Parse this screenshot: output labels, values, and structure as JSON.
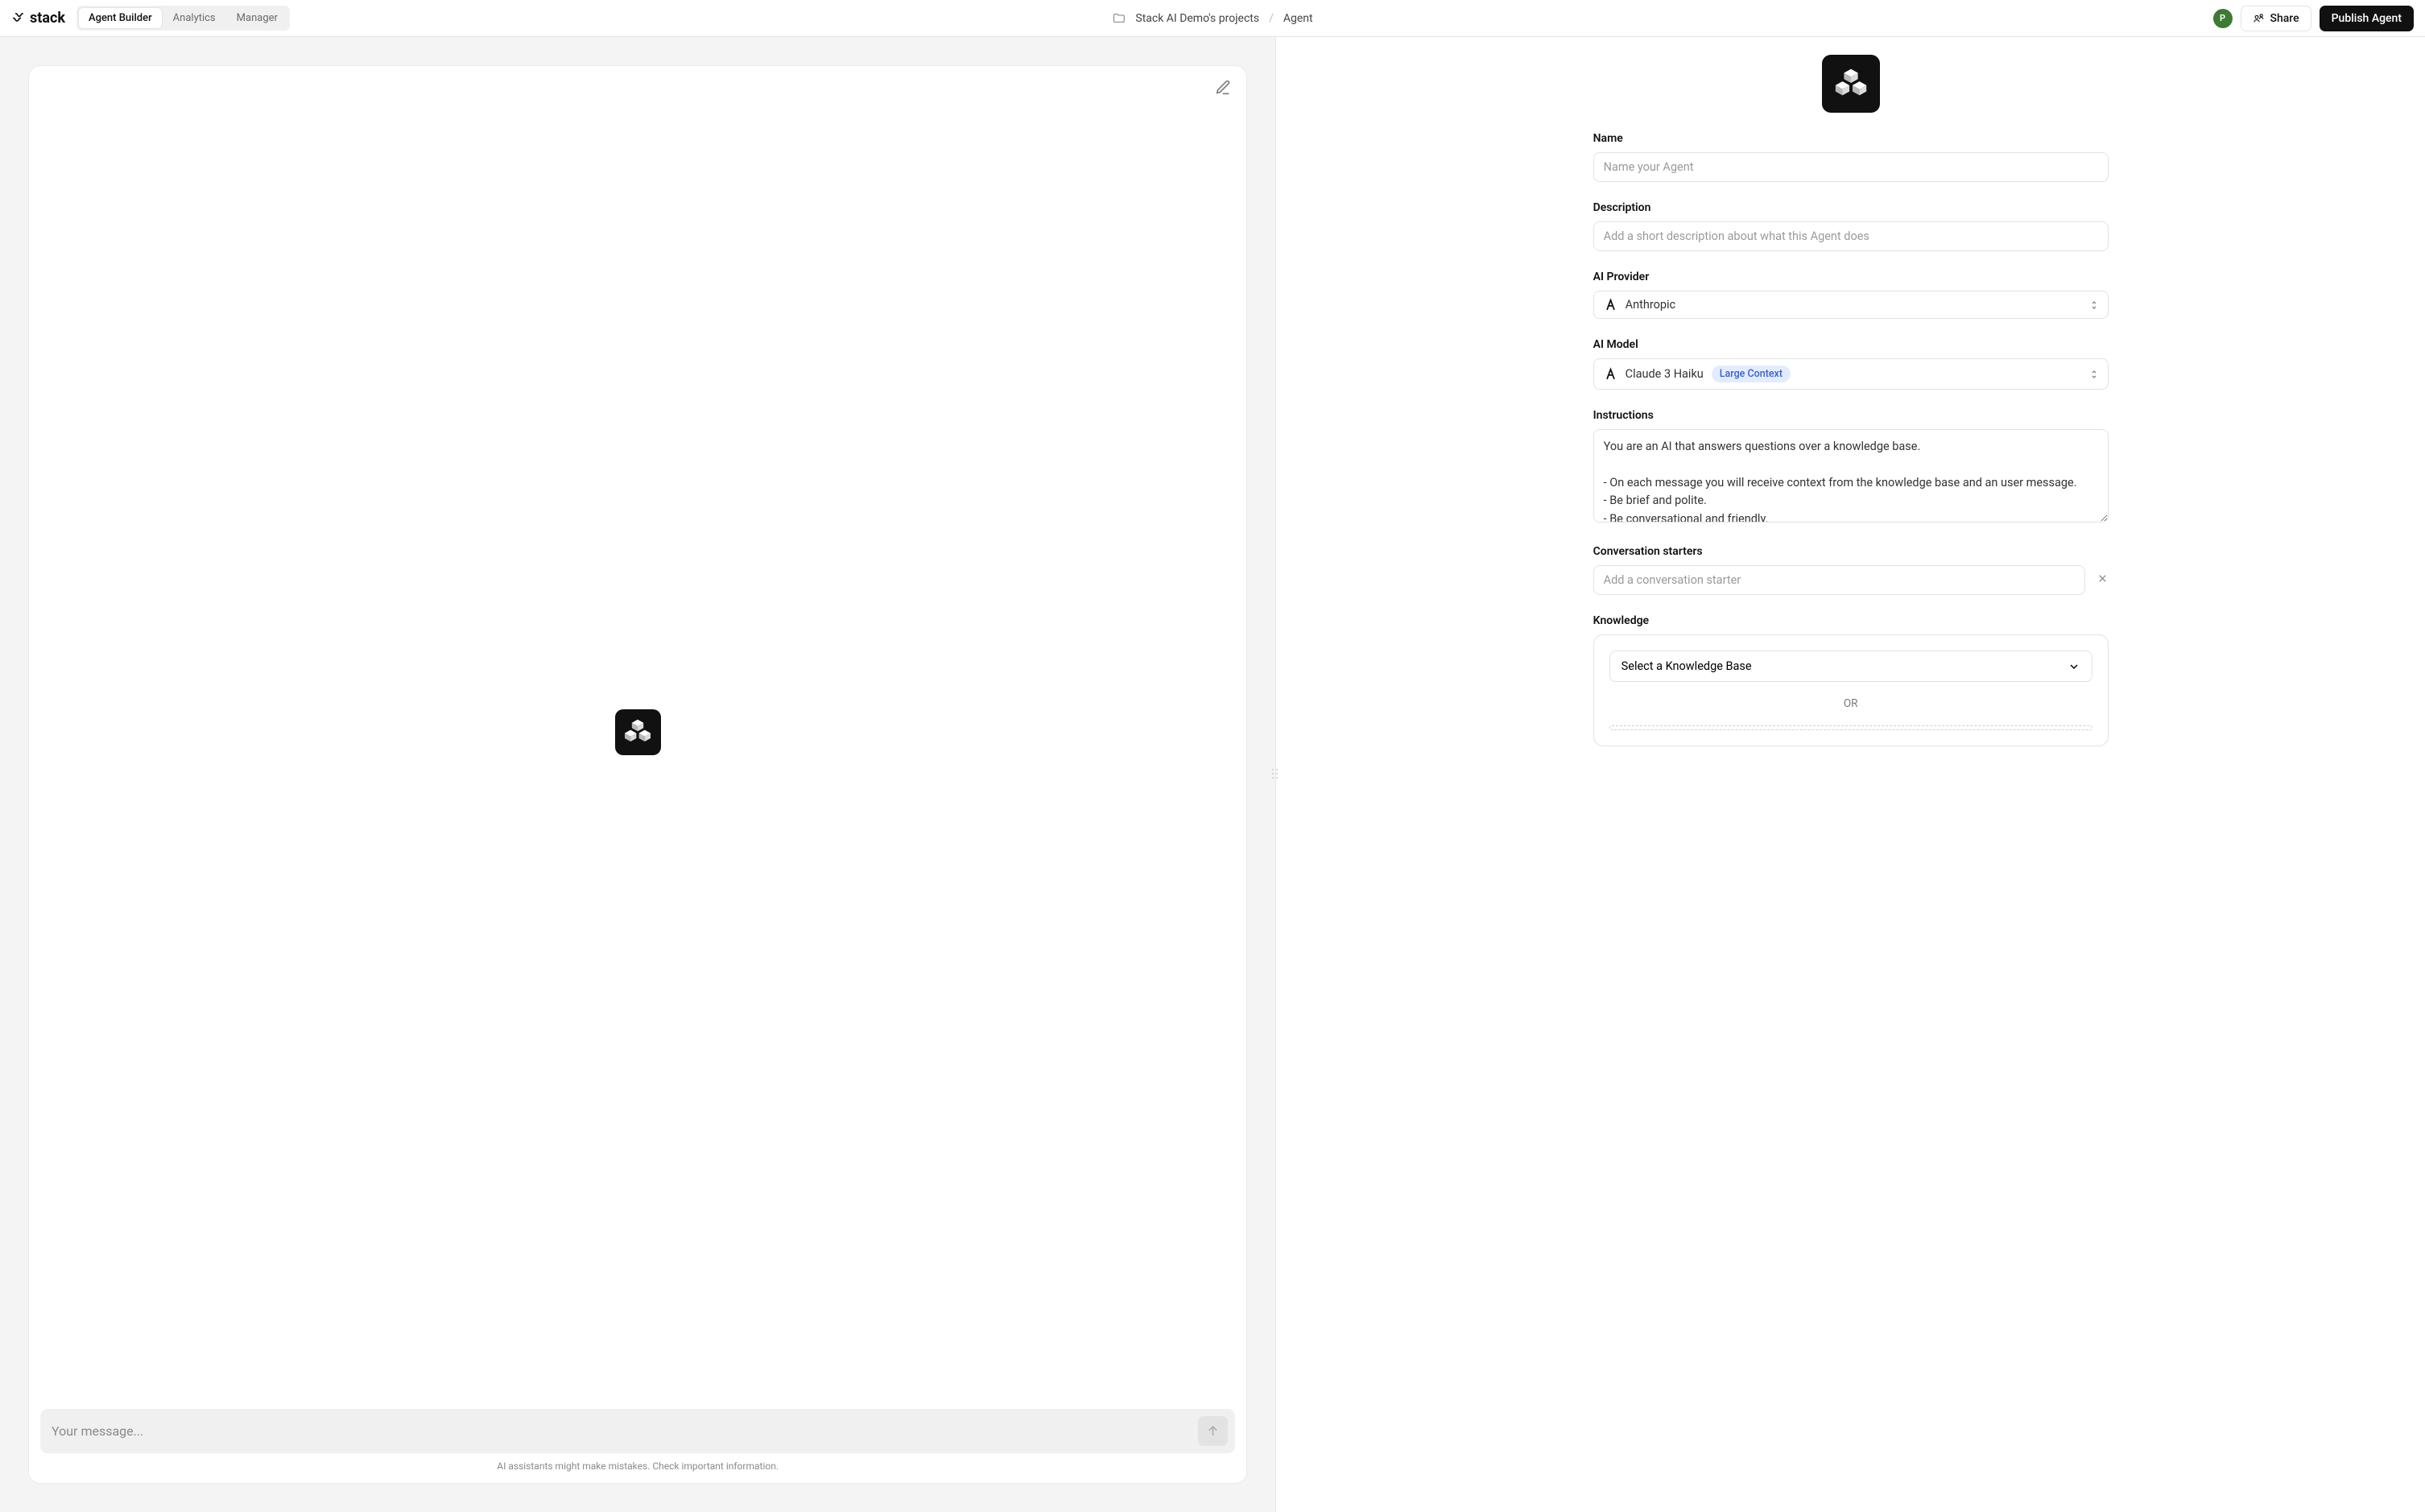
{
  "brand": "stack",
  "tabs": [
    "Agent Builder",
    "Analytics",
    "Manager"
  ],
  "active_tab": 0,
  "breadcrumb": {
    "project": "Stack AI Demo's projects",
    "page": "Agent"
  },
  "header": {
    "avatar_letter": "P",
    "share_label": "Share",
    "publish_label": "Publish Agent"
  },
  "chat": {
    "placeholder": "Your message...",
    "disclaimer": "AI assistants might make mistakes. Check important information."
  },
  "form": {
    "name_label": "Name",
    "name_placeholder": "Name your Agent",
    "desc_label": "Description",
    "desc_placeholder": "Add a short description about what this Agent does",
    "provider_label": "AI Provider",
    "provider_value": "Anthropic",
    "model_label": "AI Model",
    "model_value": "Claude 3 Haiku",
    "model_badge": "Large Context",
    "instructions_label": "Instructions",
    "instructions_value": "You are an AI that answers questions over a knowledge base.\n\n- On each message you will receive context from the knowledge base and an user message.\n- Be brief and polite.\n- Be conversational and friendly.",
    "starters_label": "Conversation starters",
    "starter_placeholder": "Add a conversation starter",
    "knowledge_label": "Knowledge",
    "kb_select_label": "Select a Knowledge Base",
    "or_label": "OR"
  }
}
